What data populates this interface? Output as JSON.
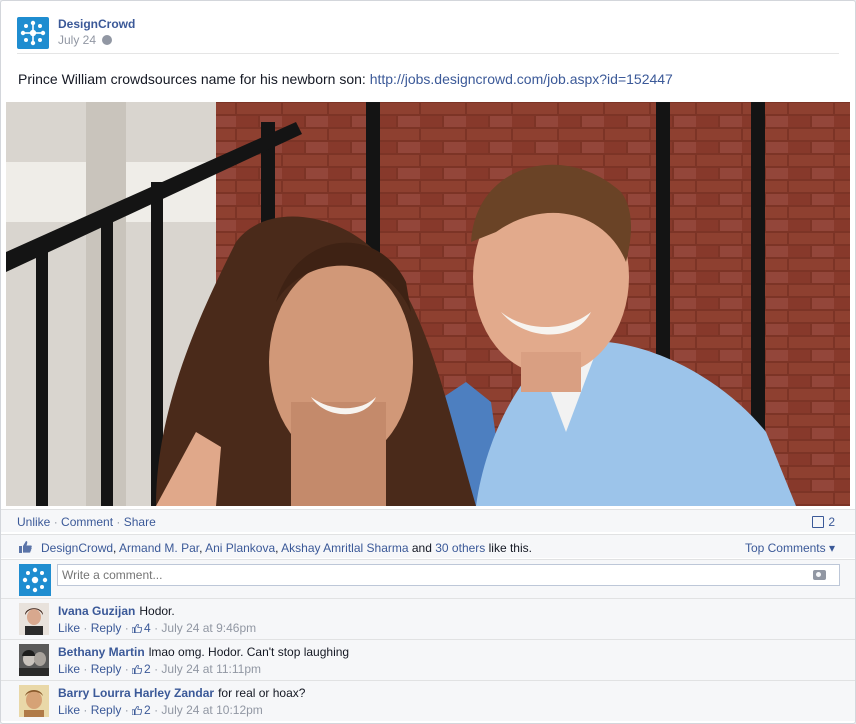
{
  "post": {
    "page_name": "DesignCrowd",
    "date": "July 24",
    "text": "Prince William crowdsources name for his newborn son: ",
    "link": "http://jobs.designcrowd.com/job.aspx?id=152447"
  },
  "actions": {
    "unlike": "Unlike",
    "comment": "Comment",
    "share": "Share",
    "dot": " · ",
    "comment_count": "2"
  },
  "likes": {
    "names": [
      "DesignCrowd",
      "Armand M. Par",
      "Ani Plankova",
      "Akshay Amritlal Sharma"
    ],
    "sep": ", ",
    "and_text": " and ",
    "others": "30 others",
    "suffix": " like this.",
    "top_comments": "Top Comments ▾"
  },
  "composer": {
    "placeholder": "Write a comment..."
  },
  "comments": [
    {
      "author": "Ivana Guzijan",
      "text": "Hodor.",
      "like": "Like",
      "reply": "Reply",
      "likes": "4",
      "time": "July 24 at 9:46pm"
    },
    {
      "author": "Bethany Martin",
      "text": "lmao omg. Hodor. Can't stop laughing",
      "like": "Like",
      "reply": "Reply",
      "likes": "2",
      "time": "July 24 at 11:11pm"
    },
    {
      "author": "Barry Lourra Harley Zandar",
      "text": "for real or hoax?",
      "like": "Like",
      "reply": "Reply",
      "likes": "2",
      "time": "July 24 at 10:12pm"
    }
  ],
  "colors": {
    "link": "#3b5998",
    "brand": "#1f8dd0",
    "muted": "#9197a3"
  }
}
